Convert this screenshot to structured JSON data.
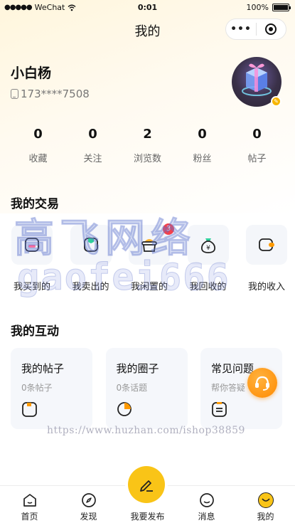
{
  "status_bar": {
    "carrier": "WeChat",
    "time": "0:01",
    "battery": "100%",
    "battery_level": 1.0
  },
  "nav": {
    "title": "我的",
    "more_label": "•••"
  },
  "profile": {
    "name": "小白杨",
    "phone": "173****7508"
  },
  "stats": [
    {
      "value": "0",
      "label": "收藏"
    },
    {
      "value": "0",
      "label": "关注"
    },
    {
      "value": "2",
      "label": "浏览数"
    },
    {
      "value": "0",
      "label": "粉丝"
    },
    {
      "value": "0",
      "label": "帖子"
    }
  ],
  "trade": {
    "title": "我的交易",
    "items": [
      {
        "label": "我买到的",
        "icon": "bag-icon"
      },
      {
        "label": "我卖出的",
        "icon": "sold-box-icon"
      },
      {
        "label": "我闲置的",
        "icon": "basket-icon",
        "badge": "3"
      },
      {
        "label": "我回收的",
        "icon": "money-bag-icon",
        "symbol": "¥"
      },
      {
        "label": "我的收入",
        "icon": "wallet-icon"
      }
    ]
  },
  "interact": {
    "title": "我的互动",
    "cards": [
      {
        "title": "我的帖子",
        "subtitle": "0条帖子",
        "icon": "post-icon"
      },
      {
        "title": "我的圈子",
        "subtitle": "0条话题",
        "icon": "circle-pie-icon"
      },
      {
        "title": "常见问题",
        "subtitle": "帮你答疑",
        "icon": "faq-icon"
      }
    ]
  },
  "watermark": {
    "line1": "高飞网络",
    "line2": "gaofei666",
    "line3": "https://www.huzhan.com/ishop38859"
  },
  "tabbar": {
    "items": [
      {
        "label": "首页",
        "icon": "home-icon"
      },
      {
        "label": "发现",
        "icon": "compass-icon"
      },
      {
        "label": "我要发布",
        "icon": "pencil-icon"
      },
      {
        "label": "消息",
        "icon": "message-icon"
      },
      {
        "label": "我的",
        "icon": "profile-face-icon",
        "active": true
      }
    ]
  },
  "colors": {
    "accent": "#f9c417",
    "orange": "#ff8a00",
    "badge": "#f2414d",
    "tile_bg": "#f4f6fa"
  }
}
